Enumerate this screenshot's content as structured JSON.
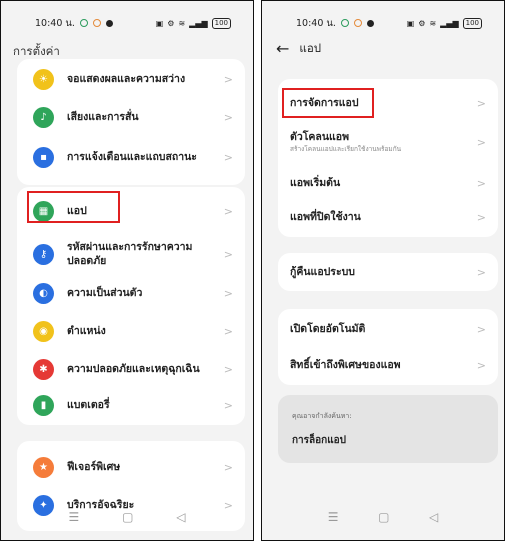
{
  "status": {
    "time": "10:40 น.",
    "battery": "100"
  },
  "left": {
    "title": "การตั้งค่า",
    "groups": [
      {
        "items": [
          {
            "label": "จอแสดงผลและความสว่าง",
            "icon": "sun-icon",
            "color": "#f1c21b"
          },
          {
            "label": "เสียงและการสั่น",
            "icon": "bell-icon",
            "color": "#2fa55a"
          },
          {
            "label": "การแจ้งเตือนและแถบสถานะ",
            "icon": "notification-icon",
            "color": "#2a6fe0"
          }
        ]
      },
      {
        "items": [
          {
            "label": "แอป",
            "icon": "apps-grid-icon",
            "color": "#2fa55a"
          },
          {
            "label": "รหัสผ่านและการรักษาความปลอดภัย",
            "icon": "key-icon",
            "color": "#2a6fe0"
          },
          {
            "label": "ความเป็นส่วนตัว",
            "icon": "privacy-icon",
            "color": "#2a6fe0"
          },
          {
            "label": "ตำแหน่ง",
            "icon": "location-icon",
            "color": "#f1c21b"
          },
          {
            "label": "ความปลอดภัยและเหตุฉุกเฉิน",
            "icon": "emergency-icon",
            "color": "#e53935"
          },
          {
            "label": "แบตเตอรี่",
            "icon": "battery-icon",
            "color": "#2fa55a"
          }
        ]
      },
      {
        "items": [
          {
            "label": "ฟีเจอร์พิเศษ",
            "icon": "star-icon",
            "color": "#f57c3a"
          },
          {
            "label": "บริการอัจฉริยะ",
            "icon": "smart-services-icon",
            "color": "#2a6fe0"
          }
        ]
      }
    ]
  },
  "right": {
    "title": "แอป",
    "groups": [
      {
        "items": [
          {
            "label": "การจัดการแอป"
          },
          {
            "label": "ตัวโคลนแอพ",
            "sub": "สร้างโคลนแอปและเรียกใช้งานพร้อมกัน"
          },
          {
            "label": "แอพเริ่มต้น"
          },
          {
            "label": "แอพที่ปิดใช้งาน"
          }
        ]
      },
      {
        "items": [
          {
            "label": "กู้คืนแอประบบ"
          }
        ]
      },
      {
        "items": [
          {
            "label": "เปิดโดยอัตโนมัติ"
          },
          {
            "label": "สิทธิ์เข้าถึงพิเศษของแอพ"
          }
        ]
      }
    ],
    "hint": {
      "heading": "คุณอาจกำลังค้นหา:",
      "value": "การล็อกแอป"
    }
  },
  "navbar": {
    "menu": "☰",
    "home": "▢",
    "back": "◁"
  }
}
